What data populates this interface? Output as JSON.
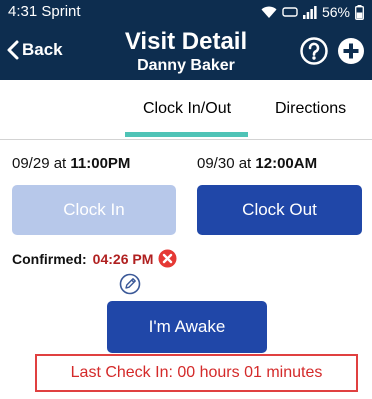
{
  "status_bar": {
    "time": "4:31 Sprint",
    "battery": "56%"
  },
  "header": {
    "back_label": "Back",
    "title": "Visit Detail",
    "subtitle": "Danny Baker"
  },
  "tabs": [
    {
      "label": "Clock In/Out",
      "active": true
    },
    {
      "label": "Directions",
      "active": false
    }
  ],
  "clock_in_date": {
    "date": "09/29 at",
    "time": "11:00PM"
  },
  "clock_out_date": {
    "date": "09/30 at",
    "time": "12:00AM"
  },
  "buttons": {
    "clock_in": "Clock In",
    "clock_out": "Clock Out",
    "awake": "I'm Awake"
  },
  "confirmed": {
    "label": "Confirmed:",
    "time": "04:26 PM"
  },
  "last_check_in": "Last Check In: 00 hours 01 minutes",
  "colors": {
    "header_bg": "#0d2d4f",
    "primary_button": "#2047a8",
    "disabled_button": "#b7c8ea",
    "tab_accent": "#4fc3b6",
    "alert_red": "#d42a2a"
  }
}
